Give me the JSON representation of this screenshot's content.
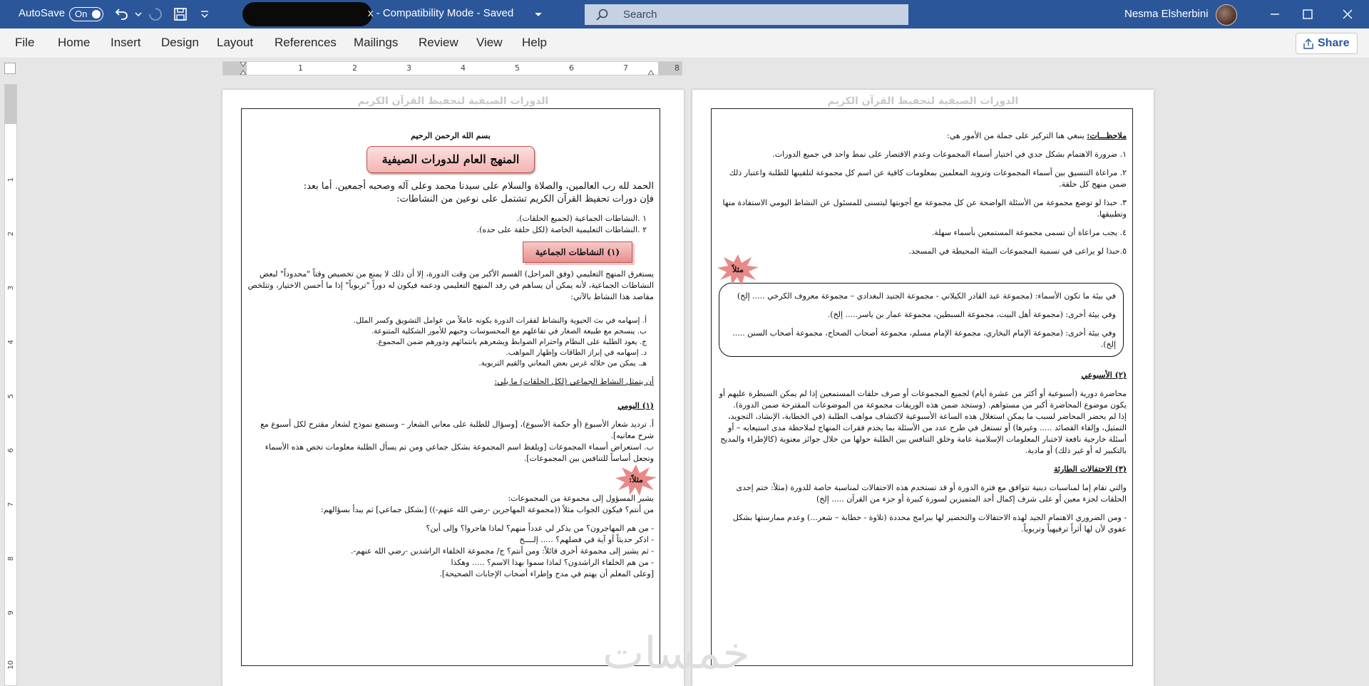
{
  "titlebar": {
    "autosave_label": "AutoSave",
    "toggle_state": "On",
    "doc_title_suffix": "x  -  Compatibility Mode  -  Saved",
    "search_placeholder": "Search",
    "user_name": "Nesma Elsherbini",
    "icons": [
      "undo-icon",
      "redo-icon",
      "save-icon",
      "customize-icon",
      "minimize-icon",
      "maximize-icon",
      "close-icon"
    ]
  },
  "ribbon": {
    "tabs": [
      "File",
      "Home",
      "Insert",
      "Design",
      "Layout",
      "References",
      "Mailings",
      "Review",
      "View",
      "Help"
    ],
    "share_label": "Share"
  },
  "ruler": {
    "h_ticks": [
      "1",
      "2",
      "3",
      "4",
      "5",
      "6",
      "7",
      "8"
    ],
    "v_ticks": [
      "1",
      "2",
      "3",
      "4",
      "5",
      "6",
      "7",
      "8",
      "9",
      "10"
    ]
  },
  "left_page": {
    "header": "الدورات الصيفية لتحفيظ القرآن الكريم",
    "basmala": "بسم الله الرحمن الرحيم",
    "title": "المنهج العام للدورات الصيفية",
    "intro_1": "الحمد لله رب العالمين، والصلاة والسلام على سيدنا محمد وعلى آله وصحبه أجمعين. أما بعد:",
    "intro_2": "فإن دورات تحفيظ القرآن الكريم تشتمل على نوعين من النشاطات:",
    "types": [
      "١ .النشاطات الجماعية (لجميع الحلقات).",
      "٢ .النشاطات التعليمية الخاصة (لكل حلقة على حده)."
    ],
    "section_1_title": "(١) النشاطات الجماعية",
    "section_1_para": "يستغرق المنهج التعليمي (وفق المراحل) القسم الأكبر من وقت الدورة، إلا أن ذلك لا يمنع من تخصيص وقتاً \"محدوداً\" لبعض النشاطات الجماعية، لأنه يمكن أن يساهم في رفد المنهج التعليمي ودعمه فيكون له دوراً \"تربوياً\" إذا ما أحسن الاختيار، وتتلخص مقاصد هذا النشاط بالآتي:",
    "goals": [
      "أ. إسهامه في بث الحيوية والنشاط لفقرات الدورة بكونه عاملاً من عوامل التشويق وكسر الملل.",
      "ب. ينسجم مع طبيعة الصغار في تفاعلهم مع المحسوسات وحبهم للأمور الشكلية المتنوعة.",
      "ج. يعود الطلبة على النظام واحترام الضوابط ويشعرهم بانتمائهم ودورهم ضمن المجموع.",
      "د. إسهامه في إبراز الطاقات وإظهار المواهب.",
      "هـ. يمكن من خلاله غرس بعض المعاني والقيم التربوية."
    ],
    "represent": "أن يتمثل النشاط الجماعي (لكل الحلقات) ما يلي:",
    "daily_title": "(١) اليومي",
    "daily_items": [
      "أ. ترديد شعار الأسبوع (أو حكمة الأسبوع)، [وسؤال للطلبة على معاني الشعار – وسنضع نموذج لشعار مقترح لكل أسبوع مع شرح معانيه].",
      "ب. استعراض أسماء المجموعات [ويلفظ اسم المجموعة بشكل جماعي ومن تم يسأل الطلبة معلومات تخص هذه الأسماء وتجعل أساساً للتنافس بين المجموعات]."
    ],
    "example_label": "مثلاً:",
    "example_1": "يشير المسؤول إلى مجموعة من المجموعات:",
    "example_2": "من أنتم؟ فيكون الجواب مثلاً ((مجموعة المهاجرين -رضي الله عنهم-)) [بشكل جماعي] ثم يبدأ بسؤالهم:",
    "questions": [
      "- من هم المهاجرون؟ من يذكر لي عدداً منهم؟ لماذا هاجروا؟ وإلى أين؟",
      "- اذكر حديثاً أو آية في فضلهم؟ ..... إلــــخ",
      "- ثم يشير إلى مجموعة أخرى قائلاً: ومن أنتم؟ ج/ مجموعة الخلفاء الراشدين -رضي الله عنهم-.",
      "- من هم الخلفاء الراشدون؟ لماذا سموا بهذا الاسم؟ ..... وهكذا",
      "[وعلى المعلم أن يهتم في مدح وإطراء أصحاب الإجابات الصحيحة]."
    ]
  },
  "right_page": {
    "header": "الدورات الصيفية لتحفيظ القرآن الكريم",
    "notes_title": "ملاحظـــات:",
    "notes_intro": "ينبغي هنا التركيز على جملة من الأمور هي:",
    "notes": [
      "١. ضرورة الاهتمام بشكل جدي في اختيار أسماء المجموعات وعدم الاقتصار على نمط واحد في جميع الدورات.",
      "٢. مراعاة التنسيق بين أسماء المجموعات وتزويد المعلمين بمعلومات كافية عن اسم كل مجموعة لتلقينها للطلبة واعتبار ذلك ضمن منهج كل حلقة.",
      "٣. حبذا لو توضع مجموعة من الأسئلة الواضحة عن كل مجموعة مع أجوبتها ليتسنى للمسئول عن النشاط اليومي الاستفادة منها وتطبيقها.",
      "٤. يجب مراعاة أن تسمى مجموعة المستمعين بأسماء سهلة.",
      "٥.حبذا لو يراعى في تسمية المجموعات البيئة المحيطة في المسجد."
    ],
    "example_label": "مثلاً",
    "env_examples": [
      "في بيئة ما تكون الأسماء: (مجموعة عبد القادر الكيلاني - مجموعة الجنيد البغدادي – مجموعة معروف الكرخي ..... إلخ)",
      "وفي بيئة أخرى: (مجموعة أهل البيت، مجموعة السبطين، مجموعة عمار بن ياسر..... إلخ).",
      "وفي بيئة أخرى: (مجموعة الإمام البخاري، مجموعة الإمام مسلم، مجموعة أصحاب الصحاح، مجموعة أصحاب السنن ..... إلخ)."
    ],
    "weekly_title": "(٢) الأسبوعي",
    "weekly_para_1": "محاضرة دورية (أسبوعية أو أكثر من عشرة أيام) لجميع المجموعات أو صرف حلقات المستمعين إذا لم يمكن السيطرة عليهم أو يكون موضوع المحاضرة أكبر من مستواهم. (وستجد ضمن هذه الوريقات مجموعة من الموضوعات المقترحة ضمن الدورة).",
    "weekly_para_2": "إذا لم يحضر المحاضر لسبب ما يمكن استغلال هذه الساعة الأسبوعية لاكتشاف مواهب الطلبة (في الخطابة، الإنشاد، التجويد، التمثيل، وإلقاء القصائد ..... وغيرها) أو تستغل في طرح عدد من الأسئلة بما يخدم فقرات المنهاج لملاحظة مدى استيعابه – أو أسئلة خارجية نافعة لاختبار المعلومات الإسلامية عامة وخلق التنافس بين الطلبة حولها من خلال جوائز معنوية (كالإطراء والمديح بالتكبير له أو غير ذلك) أو مادية.",
    "emergency_title": "(٣) الاحتفالات الطارئة",
    "emergency_para_1": "والتي تقام إما لمناسبات دينية تتوافق مع فترة الدورة أو قد تستخدم هذه الاحتفالات لمناسبة خاصة للدورة (مثلاً: ختم إحدى الحلقات لجزء معين أو على شرف إكمال أحد المتميزين لسورة كبيرة أو جزء من القرآن ..... إلخ)",
    "emergency_para_2": "- ومن الضروري الاهتمام الجيد لهذه الاحتفالات والتحضير لها ببرامج محددة (تلاوة - خطابة – شعر...) وعدم ممارستها بشكل عفوي لأن لها أثراً ترفيهياً وتربوياً."
  },
  "watermark": "خمسات",
  "colors": {
    "titlebar": "#2b579a",
    "search_box": "#c6d2e4",
    "title_box": "#f4b4b2",
    "section_box": "#e8908e",
    "starburst": "#e88a88"
  }
}
